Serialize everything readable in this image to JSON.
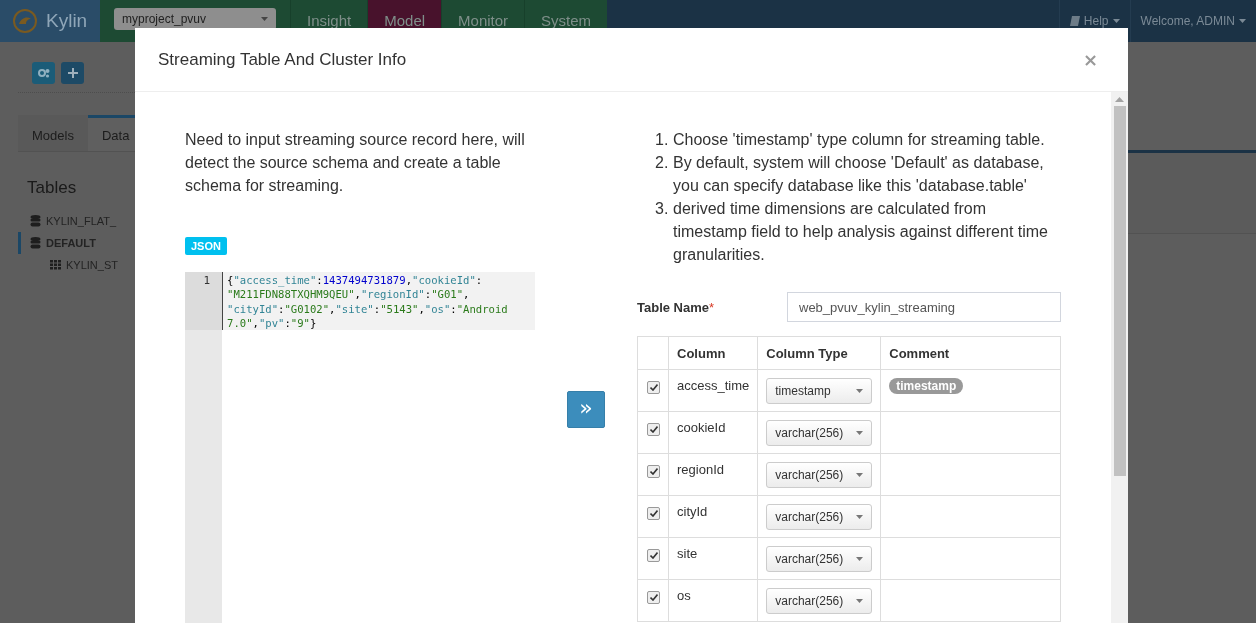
{
  "navbar": {
    "brand": "Kylin",
    "project": "myproject_pvuv",
    "tabs": [
      {
        "label": "Insight",
        "selected": false
      },
      {
        "label": "Model",
        "selected": true
      },
      {
        "label": "Monitor",
        "selected": false
      },
      {
        "label": "System",
        "selected": false
      }
    ],
    "help": "Help",
    "user": "Welcome, ADMIN"
  },
  "sidebar": {
    "tabs": [
      {
        "label": "Models",
        "selected": false
      },
      {
        "label": "Data",
        "selected": true
      }
    ],
    "heading": "Tables",
    "tree": [
      {
        "label": "KYLIN_FLAT_",
        "kind": "database",
        "selected": false
      },
      {
        "label": "DEFAULT",
        "kind": "database",
        "selected": true,
        "children": [
          {
            "label": "KYLIN_ST",
            "kind": "table",
            "selected": false
          }
        ]
      }
    ]
  },
  "modal": {
    "title": "Streaming Table And Cluster Info",
    "close": "×",
    "intro": "Need to input streaming source record here, will detect the source schema and create a table schema for streaming.",
    "source_format": "JSON",
    "editor": {
      "line_number": "1",
      "tokens": [
        {
          "kind": "punct",
          "text": "{"
        },
        {
          "kind": "key",
          "text": "\"access_time\""
        },
        {
          "kind": "punct",
          "text": ":"
        },
        {
          "kind": "number",
          "text": "1437494731879"
        },
        {
          "kind": "punct",
          "text": ","
        },
        {
          "kind": "key",
          "text": "\"cookieId\""
        },
        {
          "kind": "punct",
          "text": ":"
        },
        {
          "kind": "string",
          "text": "\"M211FDN88TXQHM9QEU\""
        },
        {
          "kind": "punct",
          "text": ","
        },
        {
          "kind": "key",
          "text": "\"regionId\""
        },
        {
          "kind": "punct",
          "text": ":"
        },
        {
          "kind": "string",
          "text": "\"G01\""
        },
        {
          "kind": "punct",
          "text": ","
        },
        {
          "kind": "key",
          "text": "\"cityId\""
        },
        {
          "kind": "punct",
          "text": ":"
        },
        {
          "kind": "string",
          "text": "\"G0102\""
        },
        {
          "kind": "punct",
          "text": ","
        },
        {
          "kind": "key",
          "text": "\"site\""
        },
        {
          "kind": "punct",
          "text": ":"
        },
        {
          "kind": "string",
          "text": "\"5143\""
        },
        {
          "kind": "punct",
          "text": ","
        },
        {
          "kind": "key",
          "text": "\"os\""
        },
        {
          "kind": "punct",
          "text": ":"
        },
        {
          "kind": "string",
          "text": "\"Android 7.0\""
        },
        {
          "kind": "punct",
          "text": ","
        },
        {
          "kind": "key",
          "text": "\"pv\""
        },
        {
          "kind": "punct",
          "text": ":"
        },
        {
          "kind": "string",
          "text": "\"9\""
        },
        {
          "kind": "punct",
          "text": "}"
        }
      ]
    },
    "convert_button": "»",
    "instructions": [
      {
        "number": "1.",
        "text": "Choose 'timestamp' type column for streaming table."
      },
      {
        "number": "2.",
        "text": "By default, system will choose 'Default' as database, you can specify database like this 'database.table'"
      },
      {
        "number": "3.",
        "text": "derived time dimensions are calculated from timestamp field to help analysis against different time granularities."
      }
    ],
    "table_name": {
      "label": "Table Name",
      "required_mark": "*",
      "value": "web_pvuv_kylin_streaming"
    },
    "table": {
      "columns": [
        "Column",
        "Column Type",
        "Comment"
      ],
      "rows": [
        {
          "checked": true,
          "name": "access_time",
          "type": "timestamp",
          "comment": "timestamp"
        },
        {
          "checked": true,
          "name": "cookieId",
          "type": "varchar(256)"
        },
        {
          "checked": true,
          "name": "regionId",
          "type": "varchar(256)"
        },
        {
          "checked": true,
          "name": "cityId",
          "type": "varchar(256)"
        },
        {
          "checked": true,
          "name": "site",
          "type": "varchar(256)"
        },
        {
          "checked": true,
          "name": "os",
          "type": "varchar(256)"
        }
      ]
    }
  }
}
